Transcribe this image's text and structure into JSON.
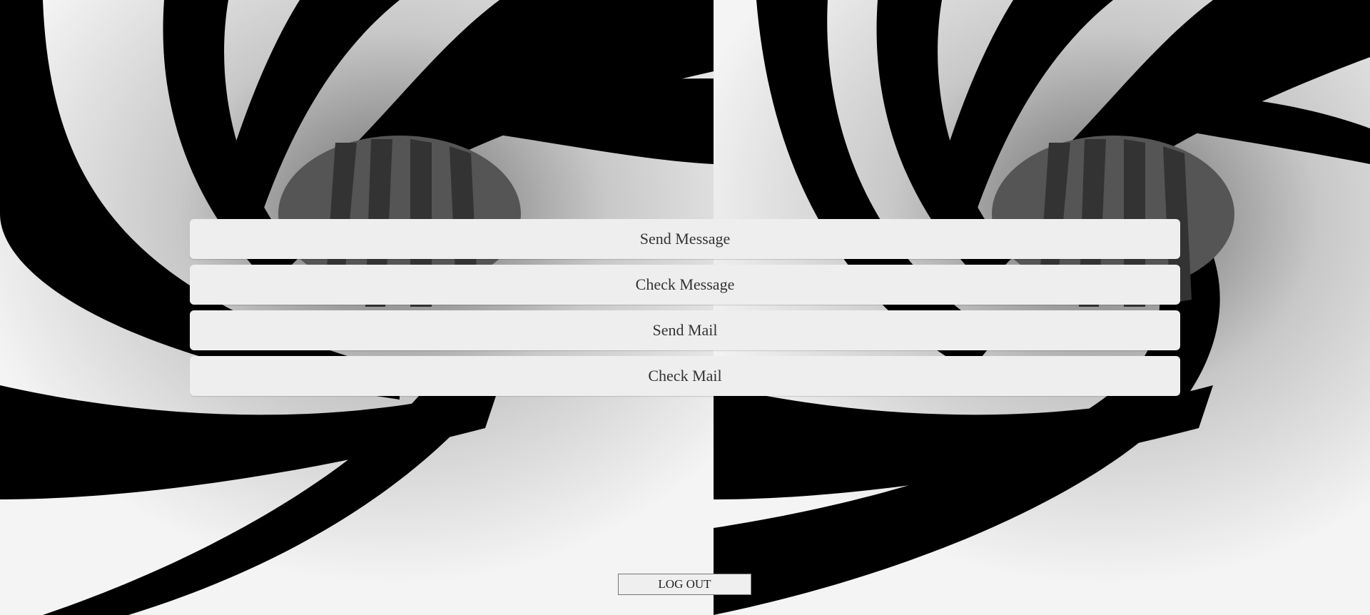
{
  "background": {
    "description_icon": "black-white-spiral-tunnel-image",
    "colors": {
      "dark": "#000000",
      "light": "#f2f2f2",
      "mid": "#9a9a9a"
    }
  },
  "menu": {
    "buttons": [
      {
        "label": "Send Message"
      },
      {
        "label": "Check Message"
      },
      {
        "label": "Send Mail"
      },
      {
        "label": "Check Mail"
      }
    ]
  },
  "logout": {
    "label": "LOG OUT"
  }
}
